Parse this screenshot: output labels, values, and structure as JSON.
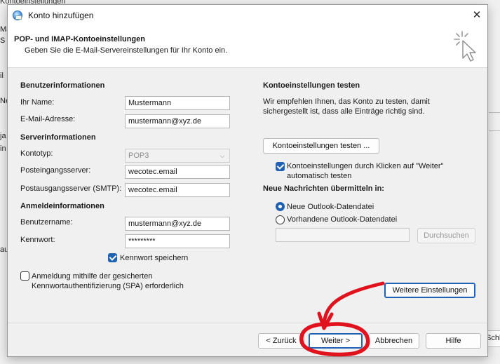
{
  "background": {
    "title_fragment": "Kontoeinstellungen",
    "fragments": [
      "Ma",
      "S",
      "il",
      "Ne",
      "ja",
      "in",
      "au"
    ],
    "right_button_fragment": "Schließ"
  },
  "dialog": {
    "title": "Konto hinzufügen",
    "close_glyph": "✕",
    "header": {
      "title": "POP- und IMAP-Kontoeinstellungen",
      "subtitle": "Geben Sie die E-Mail-Servereinstellungen für Ihr Konto ein."
    },
    "left": {
      "user_section": "Benutzerinformationen",
      "name_label": "Ihr Name:",
      "name_value": "Mustermann",
      "email_label": "E-Mail-Adresse:",
      "email_value": "mustermann@xyz.de",
      "server_section": "Serverinformationen",
      "account_type_label": "Kontotyp:",
      "account_type_value": "POP3",
      "incoming_label": "Posteingangsserver:",
      "incoming_value": "wecotec.email",
      "outgoing_label": "Postausgangsserver (SMTP):",
      "outgoing_value": "wecotec.email",
      "login_section": "Anmeldeinformationen",
      "username_label": "Benutzername:",
      "username_value": "mustermann@xyz.de",
      "password_label": "Kennwort:",
      "password_value": "*********",
      "remember_password": "Kennwort speichern",
      "spa_line1": "Anmeldung mithilfe der gesicherten",
      "spa_line2": "Kennwortauthentifizierung (SPA) erforderlich"
    },
    "right": {
      "test_section": "Kontoeinstellungen testen",
      "test_desc_line1": "Wir empfehlen Ihnen, das Konto zu testen, damit",
      "test_desc_line2": "sichergestellt ist, dass alle Einträge richtig sind.",
      "test_button": "Kontoeinstellungen testen ...",
      "auto_test_line1": "Kontoeinstellungen durch Klicken auf \"Weiter\"",
      "auto_test_line2": "automatisch testen",
      "deliver_section": "Neue Nachrichten übermitteln in:",
      "new_datafile": "Neue Outlook-Datendatei",
      "existing_datafile": "Vorhandene Outlook-Datendatei",
      "existing_path": "",
      "browse_button": "Durchsuchen",
      "more_settings_button": "Weitere Einstellungen"
    },
    "footer": {
      "back_button": "< Zurück",
      "next_button": "Weiter >",
      "cancel_button": "Abbrechen",
      "help_button": "Hilfe"
    }
  },
  "colors": {
    "accent": "#1f62b3",
    "annotation": "#e0121d"
  },
  "icons": {
    "window": "outlook-globe-icon",
    "header": "cursor-click-icon",
    "dropdown": "chevron-down-icon"
  }
}
